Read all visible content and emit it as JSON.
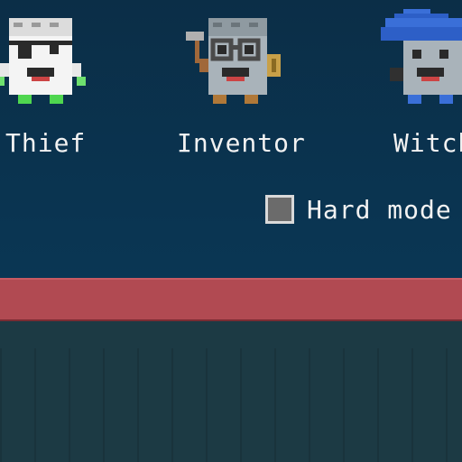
{
  "characters": [
    {
      "id": "thief",
      "label": "Thief",
      "icon": "thief-icon"
    },
    {
      "id": "inventor",
      "label": "Inventor",
      "icon": "inventor-icon"
    },
    {
      "id": "witch",
      "label": "Witch",
      "icon": "witch-icon"
    }
  ],
  "options": {
    "hard_mode_label": "Hard mode",
    "hard_mode_checked": false
  },
  "colors": {
    "background": "#0a3552",
    "band": "#b14a52",
    "ground": "#1c3a44",
    "text": "#f2f2f2"
  }
}
